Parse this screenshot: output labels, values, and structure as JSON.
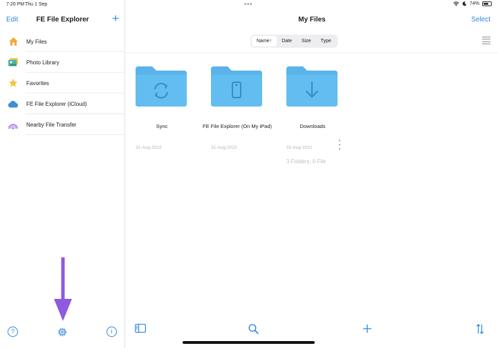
{
  "status": {
    "time": "7:20 PM",
    "date": "Thu 1 Sep",
    "dots": "•••",
    "battery": "74%",
    "battery_level": 0.74
  },
  "sidebar": {
    "edit_label": "Edit",
    "title": "FE File Explorer",
    "add_symbol": "+",
    "items": [
      {
        "label": "My Files",
        "icon": "home-icon"
      },
      {
        "label": "Photo Library",
        "icon": "photo-library-icon"
      },
      {
        "label": "Favorites",
        "icon": "star-icon"
      },
      {
        "label": "FE File Explorer (iCloud)",
        "icon": "cloud-icon"
      },
      {
        "label": "Nearby File Transfer",
        "icon": "wireless-icon"
      }
    ],
    "footer": {
      "help_symbol": "?",
      "info_symbol": "i"
    }
  },
  "main": {
    "title": "My Files",
    "select_label": "Select",
    "sort": [
      {
        "label": "Name↑",
        "active": true
      },
      {
        "label": "Date",
        "active": false
      },
      {
        "label": "Size",
        "active": false
      },
      {
        "label": "Type",
        "active": false
      }
    ],
    "folders": [
      {
        "name": "Sync",
        "date": "31-Aug-2022",
        "icon": "sync-icon"
      },
      {
        "name": "FE File Explorer (On My iPad)",
        "date": "31-Aug-2022",
        "icon": "ipad-icon"
      },
      {
        "name": "Downloads",
        "date": "31-Aug-2022",
        "icon": "download-icon"
      }
    ],
    "summary": "3 Folders, 0 File"
  },
  "colors": {
    "accent": "#2e86de",
    "folder": "#5ab4ea",
    "arrow": "#8e5ae0"
  }
}
